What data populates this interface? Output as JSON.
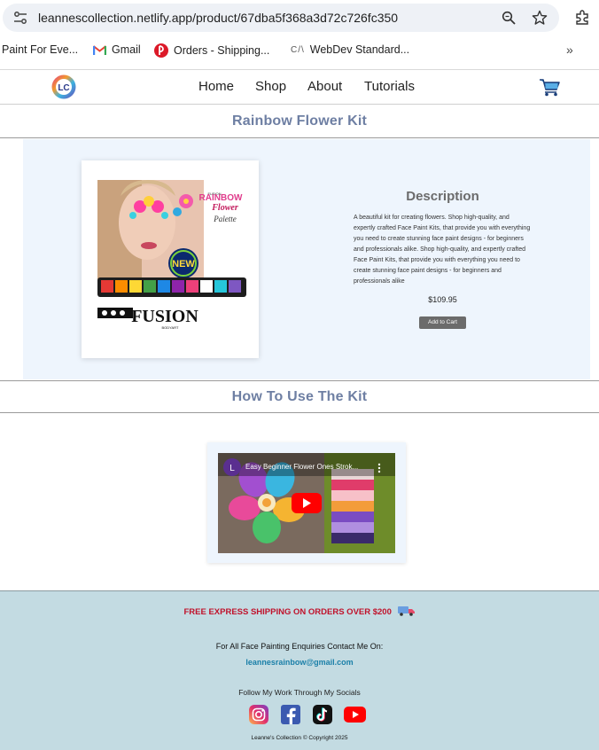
{
  "browser": {
    "url": "leannescollection.netlify.app/product/67dba5f368a3d72c726fc350",
    "bookmarks": [
      {
        "label": "Paint For Eve..."
      },
      {
        "label": "Gmail"
      },
      {
        "label": "Orders - Shipping..."
      },
      {
        "label": "WebDev Standard..."
      }
    ],
    "more": "»"
  },
  "nav": {
    "logo_text": "LC",
    "links": [
      "Home",
      "Shop",
      "About",
      "Tutorials"
    ]
  },
  "product": {
    "title": "Rainbow Flower Kit",
    "image_text": {
      "brand_small": "FUSION",
      "rainbow": "RAINBOW",
      "flower": "Flower",
      "palette": "Palette",
      "new_badge": "NEW",
      "fusion": "FUSION",
      "bodyart": "BODYART"
    },
    "description_title": "Description",
    "description": "A beautiful kit for creating flowers. Shop high-quality, and expertly crafted Face Paint Kits, that provide you with everything you need to create stunning face paint designs - for beginners and professionals alike. Shop high-quality, and expertly crafted Face Paint Kits, that provide you with everything you need to create stunning face paint designs - for beginners and professionals alike",
    "price": "$109.95",
    "add_to_cart": "Add to Cart"
  },
  "howto": {
    "title": "How To Use The Kit",
    "video_title": "Easy Beginner Flower Ones Strok...",
    "channel_initial": "L"
  },
  "footer": {
    "shipping": "FREE EXPRESS SHIPPING ON ORDERS OVER $200",
    "enquiries": "For All Face Painting Enquiries Contact Me On:",
    "email": "leannesrainbow@gmail.com",
    "follow": "Follow My Work Through My Socials",
    "socials": [
      "instagram-icon",
      "facebook-icon",
      "tiktok-icon",
      "youtube-icon"
    ],
    "copyright": "Leanne's Collection © Copyright 2025"
  },
  "colors": {
    "section_title": "#6e7fa3",
    "product_bg": "#eef5fd",
    "footer_bg": "#c3dbe2",
    "shipping_red": "#c0122b",
    "email_blue": "#1a7fa8"
  }
}
